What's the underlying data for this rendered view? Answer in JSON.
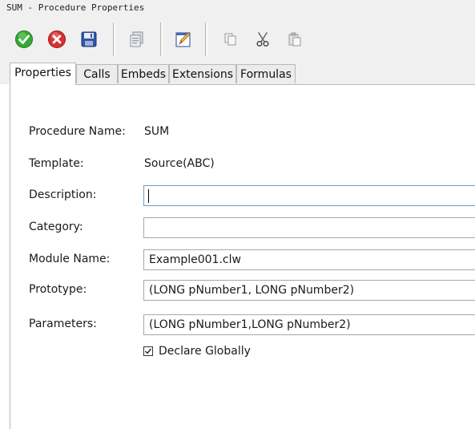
{
  "window": {
    "title": "SUM - Procedure Properties"
  },
  "toolbar": {
    "buttons": [
      {
        "name": "ok-icon",
        "color": "#2e9e2e"
      },
      {
        "name": "cancel-icon",
        "color": "#d42b2b"
      },
      {
        "name": "save-icon",
        "color": "#2c4f9e"
      },
      {
        "name": "properties-icon"
      },
      {
        "name": "edit-icon"
      },
      {
        "name": "copy-icon"
      },
      {
        "name": "cut-icon"
      },
      {
        "name": "paste-icon"
      }
    ]
  },
  "tabs": [
    {
      "label": "Properties",
      "active": true
    },
    {
      "label": "Calls",
      "active": false
    },
    {
      "label": "Embeds",
      "active": false
    },
    {
      "label": "Extensions",
      "active": false
    },
    {
      "label": "Formulas",
      "active": false
    }
  ],
  "form": {
    "procedure_name_label": "Procedure Name:",
    "procedure_name_value": "SUM",
    "template_label": "Template:",
    "template_value": "Source(ABC)",
    "description_label": "Description:",
    "description_value": "",
    "category_label": "Category:",
    "category_value": "",
    "module_name_label": "Module Name:",
    "module_name_value": "Example001.clw",
    "prototype_label": "Prototype:",
    "prototype_value": "(LONG pNumber1, LONG pNumber2)",
    "parameters_label": "Parameters:",
    "parameters_value": "(LONG pNumber1,LONG pNumber2)",
    "declare_globally_label": "Declare Globally",
    "declare_globally_checked": true
  }
}
